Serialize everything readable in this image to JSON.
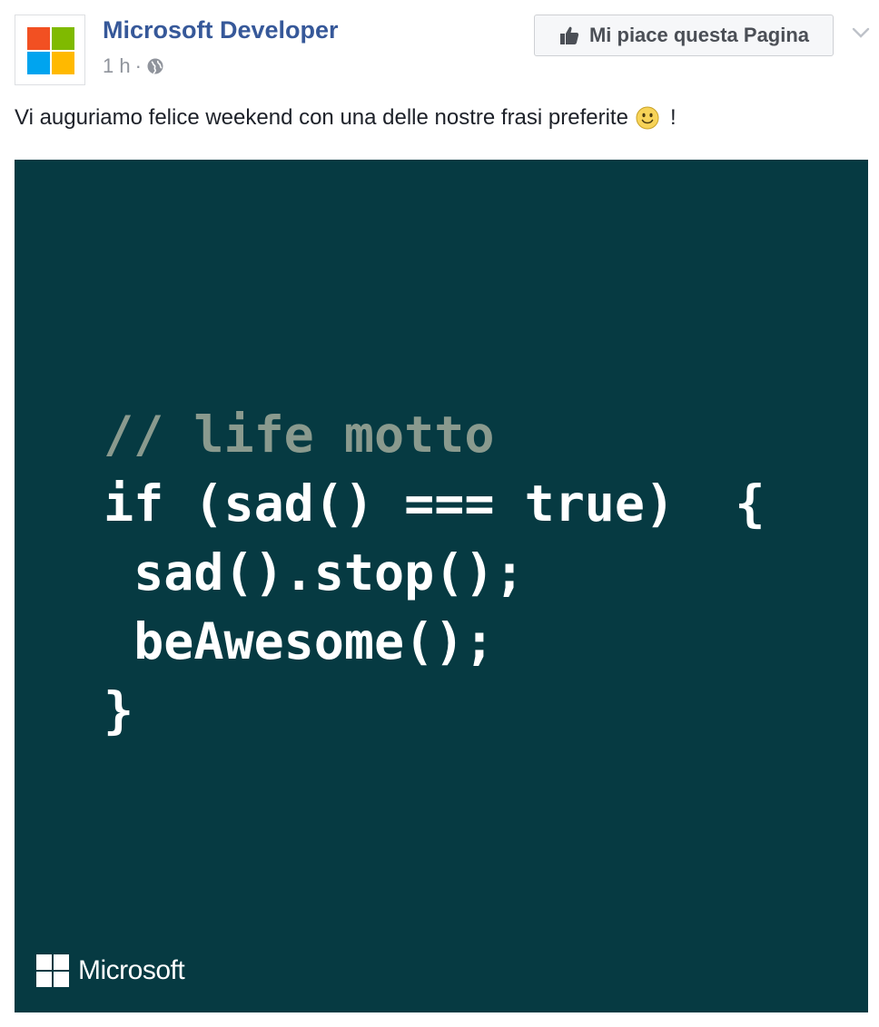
{
  "post": {
    "page_name": "Microsoft Developer",
    "time": "1 h",
    "separator": "·",
    "privacy_icon": "globe-icon",
    "like_button_label": "Mi piace questa Pagina",
    "like_icon": "thumbs-up-icon",
    "options_icon": "chevron-down-icon",
    "text": "Vi auguriamo felice weekend con una delle nostre frasi preferite",
    "text_emoji": "smile-emoji",
    "text_suffix": "!"
  },
  "image": {
    "background_color": "#063a42",
    "code_lines": [
      "// life motto",
      "if (sad() === true)  {",
      " sad().stop();",
      " beAwesome();",
      "}"
    ],
    "brand": "Microsoft"
  },
  "colors": {
    "link": "#365899",
    "meta": "#90949c",
    "ms_red": "#f25022",
    "ms_green": "#7fba00",
    "ms_blue": "#00a4ef",
    "ms_yellow": "#ffb900"
  }
}
